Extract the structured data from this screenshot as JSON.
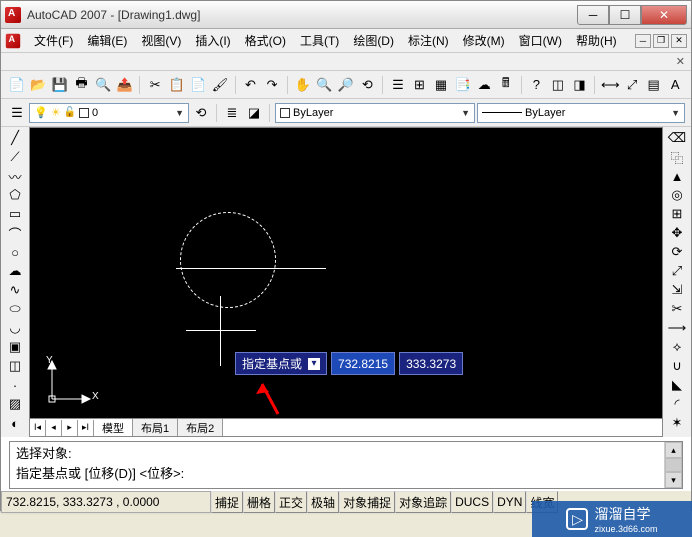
{
  "title": "AutoCAD 2007 - [Drawing1.dwg]",
  "menu": {
    "file": "文件(F)",
    "edit": "编辑(E)",
    "view": "视图(V)",
    "insert": "插入(I)",
    "format": "格式(O)",
    "tools": "工具(T)",
    "draw": "绘图(D)",
    "dimension": "标注(N)",
    "modify": "修改(M)",
    "window": "窗口(W)",
    "help": "帮助(H)"
  },
  "layer": {
    "current": "0",
    "prop": "ByLayer",
    "prop2": "ByLayer"
  },
  "dynamic": {
    "prompt": "指定基点或",
    "x": "732.8215",
    "y": "333.3273"
  },
  "ucs": {
    "x": "X",
    "y": "Y"
  },
  "layout_tabs": {
    "model": "模型",
    "layout1": "布局1",
    "layout2": "布局2"
  },
  "command": {
    "line1": "选择对象:",
    "line2": "指定基点或 [位移(D)] <位移>:"
  },
  "status": {
    "coords": "732.8215,  333.3273 , 0.0000",
    "snap": "捕捉",
    "grid": "栅格",
    "ortho": "正交",
    "polar": "极轴",
    "osnap": "对象捕捉",
    "otrack": "对象追踪",
    "ducs": "DUCS",
    "dyn": "DYN",
    "lwt": "线宽"
  },
  "watermark": {
    "brand": "溜溜自学",
    "url": "zixue.3d66.com"
  }
}
